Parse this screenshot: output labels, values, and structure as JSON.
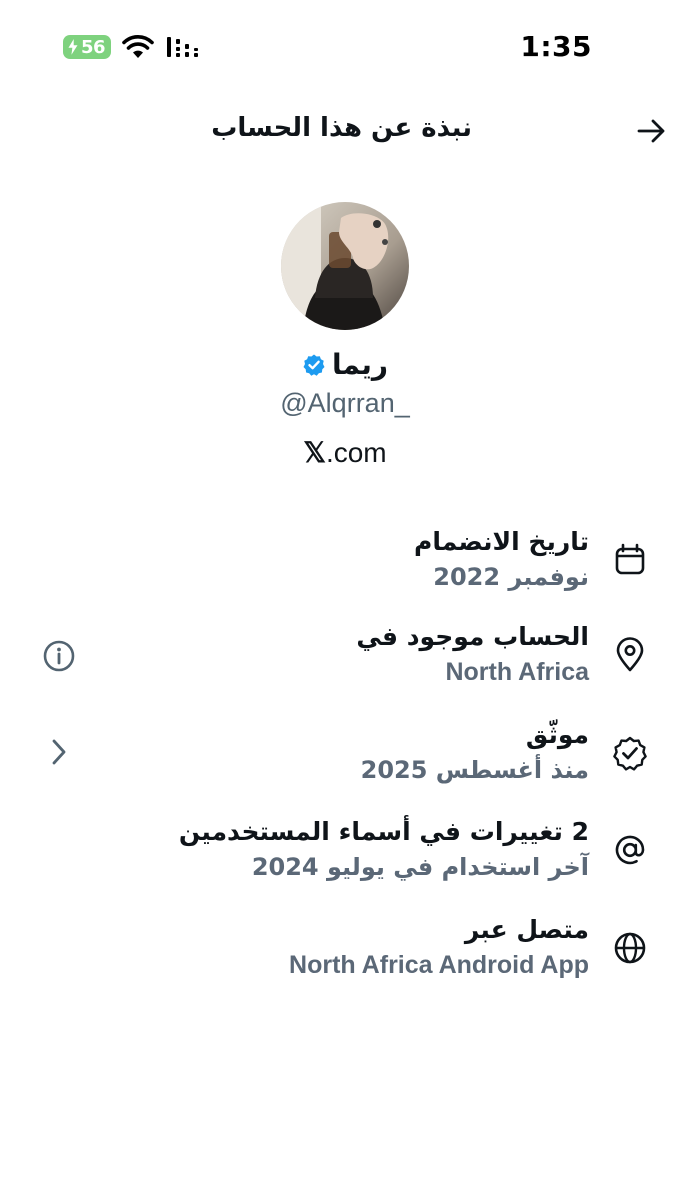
{
  "status_bar": {
    "battery_level": "56",
    "time": "1:35",
    "icons": [
      "battery-charging-icon",
      "wifi-icon",
      "cellular-signal-icon"
    ]
  },
  "header": {
    "title": "نبذة عن هذا الحساب",
    "back_icon": "arrow-icon"
  },
  "profile": {
    "display_name": "ريما",
    "verified_icon": "verified-badge-icon",
    "handle": "@Alqrran_",
    "domain_prefix": "𝕏",
    "domain_suffix": ".com"
  },
  "info_rows": [
    {
      "icon": "calendar-icon",
      "title": "تاريخ الانضمام",
      "subtitle": "نوفمبر 2022"
    },
    {
      "icon": "location-pin-icon",
      "title": "الحساب موجود في",
      "subtitle": "North Africa",
      "side_icon": "info-icon"
    },
    {
      "icon": "verified-check-icon",
      "title": "موثّق",
      "subtitle": "منذ أغسطس 2025",
      "side_icon": "chevron-icon"
    },
    {
      "icon": "at-sign-icon",
      "title": "2 تغييرات في أسماء المستخدمين",
      "subtitle": "آخر استخدام في يوليو 2024"
    },
    {
      "icon": "globe-icon",
      "title": "متصل عبر",
      "subtitle": "North Africa Android App"
    }
  ],
  "colors": {
    "text_primary": "#0f1419",
    "text_secondary": "#5b6877",
    "verified_blue": "#1d9bf0",
    "battery_green": "#7ed27e"
  }
}
